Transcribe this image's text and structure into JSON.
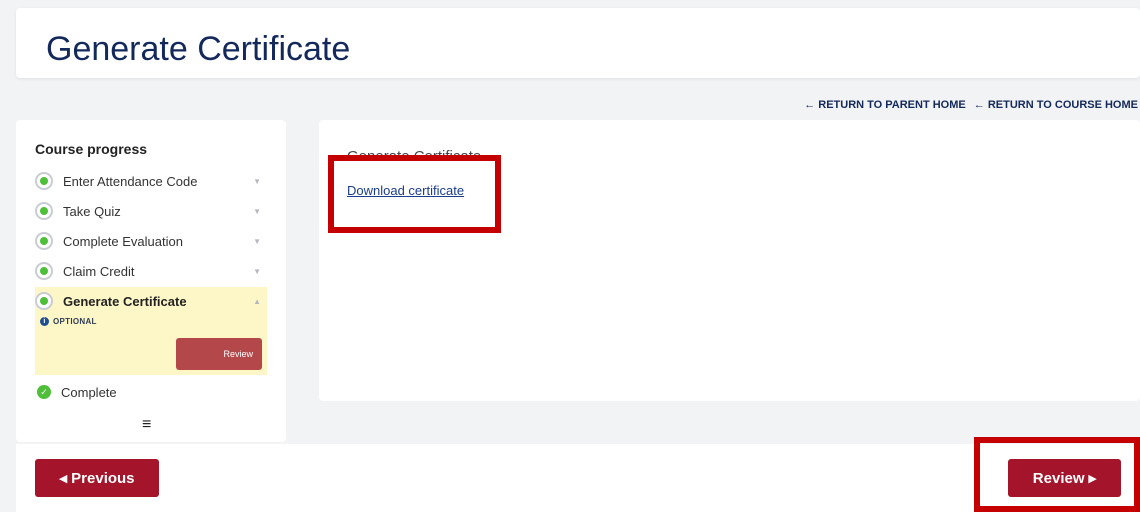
{
  "page": {
    "title": "Generate Certificate"
  },
  "nav": {
    "return_parent": "← RETURN TO PARENT HOME",
    "return_course": "← RETURN TO COURSE HOME"
  },
  "sidebar": {
    "heading": "Course progress",
    "steps": [
      {
        "label": "Enter Attendance Code",
        "caret": "▼"
      },
      {
        "label": "Take Quiz",
        "caret": "▼"
      },
      {
        "label": "Complete Evaluation",
        "caret": "▼"
      },
      {
        "label": "Claim Credit",
        "caret": "▼"
      },
      {
        "label": "Generate Certificate",
        "caret": "▲",
        "badge": "OPTIONAL",
        "action": "Review"
      }
    ],
    "complete_label": "Complete",
    "menu_icon": "≡",
    "info_icon": "i"
  },
  "main": {
    "title": "Generate Certificate",
    "download_link": "Download certificate"
  },
  "footer": {
    "previous": "◂ Previous",
    "review": "Review ▸"
  },
  "colors": {
    "accent_red": "#a4152c",
    "highlight_red": "#c40000",
    "title_navy": "#13285b",
    "step_green": "#4fbf39",
    "active_step_bg": "#fdf7c8"
  }
}
